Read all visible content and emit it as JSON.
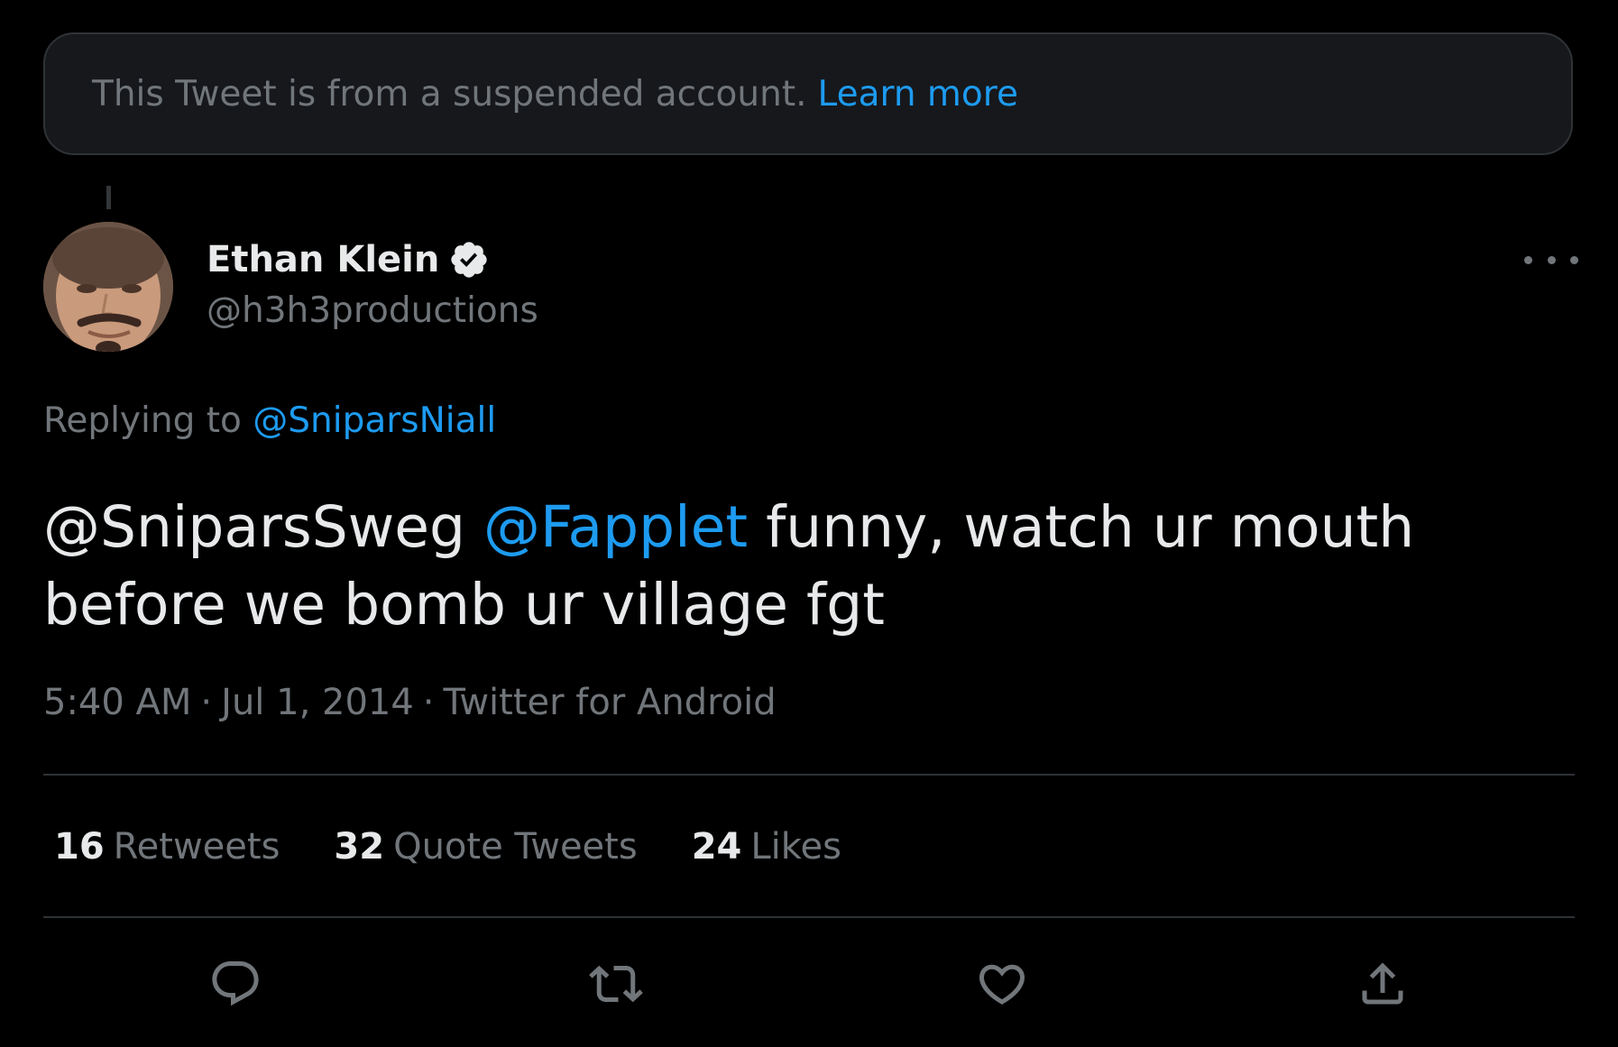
{
  "notice": {
    "text": "This Tweet is from a suspended account.",
    "link": "Learn more"
  },
  "author": {
    "name": "Ethan Klein",
    "handle": "@h3h3productions",
    "verified": true
  },
  "reply": {
    "prefix": "Replying to",
    "mention": "@SniparsNiall"
  },
  "tweet": {
    "part1": "@SniparsSweg",
    "mention": "@Fapplet",
    "part2": "funny, watch ur mouth before we bomb ur village fgt"
  },
  "meta": {
    "time": "5:40 AM",
    "date": "Jul 1, 2014",
    "source": "Twitter for Android"
  },
  "stats": {
    "retweets": {
      "count": "16",
      "label": "Retweets"
    },
    "quotes": {
      "count": "32",
      "label": "Quote Tweets"
    },
    "likes": {
      "count": "24",
      "label": "Likes"
    }
  },
  "actions": [
    "reply-icon",
    "retweet-icon",
    "like-icon",
    "share-icon"
  ],
  "colors": {
    "background": "#000000",
    "accent": "#1d9bf0",
    "text": "#e7e9ea",
    "muted": "#71767b",
    "border": "#2f3336"
  }
}
